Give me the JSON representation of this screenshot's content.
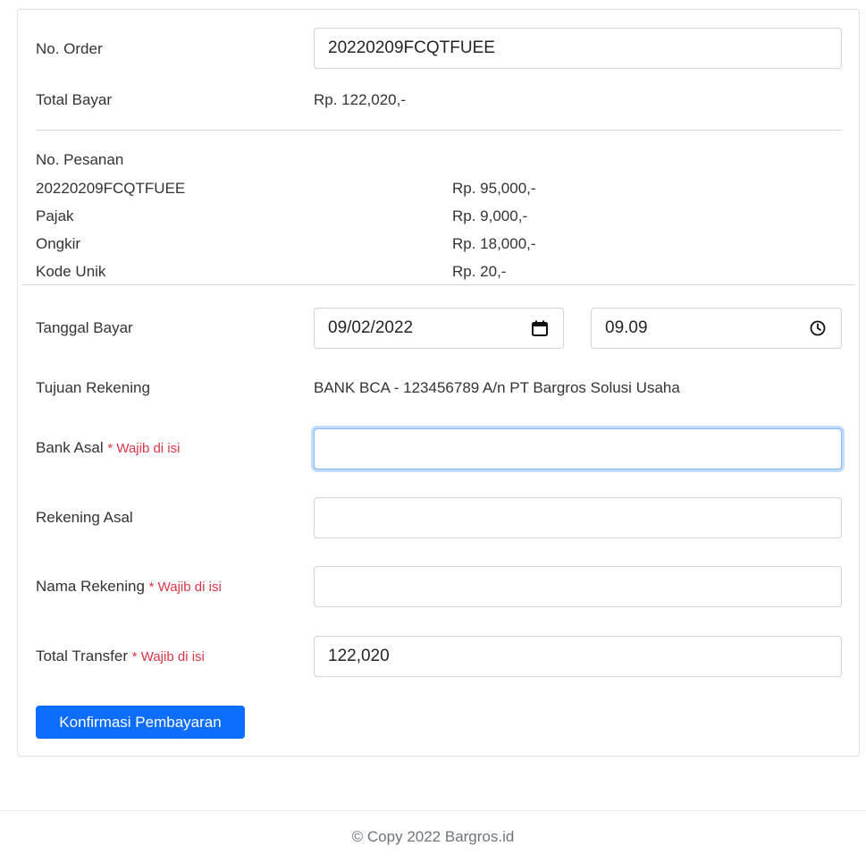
{
  "order": {
    "no_order_label": "No. Order",
    "no_order_value": "20220209FCQTFUEE",
    "total_bayar_label": "Total Bayar",
    "total_bayar_value": "Rp. 122,020,-"
  },
  "summary": {
    "no_pesanan_label": "No. Pesanan",
    "rows": [
      {
        "label": "20220209FCQTFUEE",
        "value": "Rp. 95,000,-"
      },
      {
        "label": "Pajak",
        "value": "Rp. 9,000,-"
      },
      {
        "label": "Ongkir",
        "value": "Rp. 18,000,-"
      },
      {
        "label": "Kode Unik",
        "value": "Rp. 20,-"
      }
    ]
  },
  "payment": {
    "tanggal_label": "Tanggal Bayar",
    "tanggal_value": "09/02/2022",
    "jam_value": "09.09",
    "tujuan_label": "Tujuan Rekening",
    "tujuan_value": "BANK BCA - 123456789 A/n PT Bargros Solusi Usaha",
    "bank_asal_label": "Bank Asal",
    "rekening_asal_label": "Rekening Asal",
    "nama_rekening_label": "Nama Rekening",
    "total_transfer_label": "Total Transfer",
    "total_transfer_value": "122,020",
    "required_note": "* Wajib di isi"
  },
  "submit_label": "Konfirmasi Pembayaran",
  "footer_text": "© Copy 2022 Bargros.id",
  "colors": {
    "primary": "#0d6efd",
    "required": "#dc3545",
    "focus_ring": "#86b7fe"
  }
}
